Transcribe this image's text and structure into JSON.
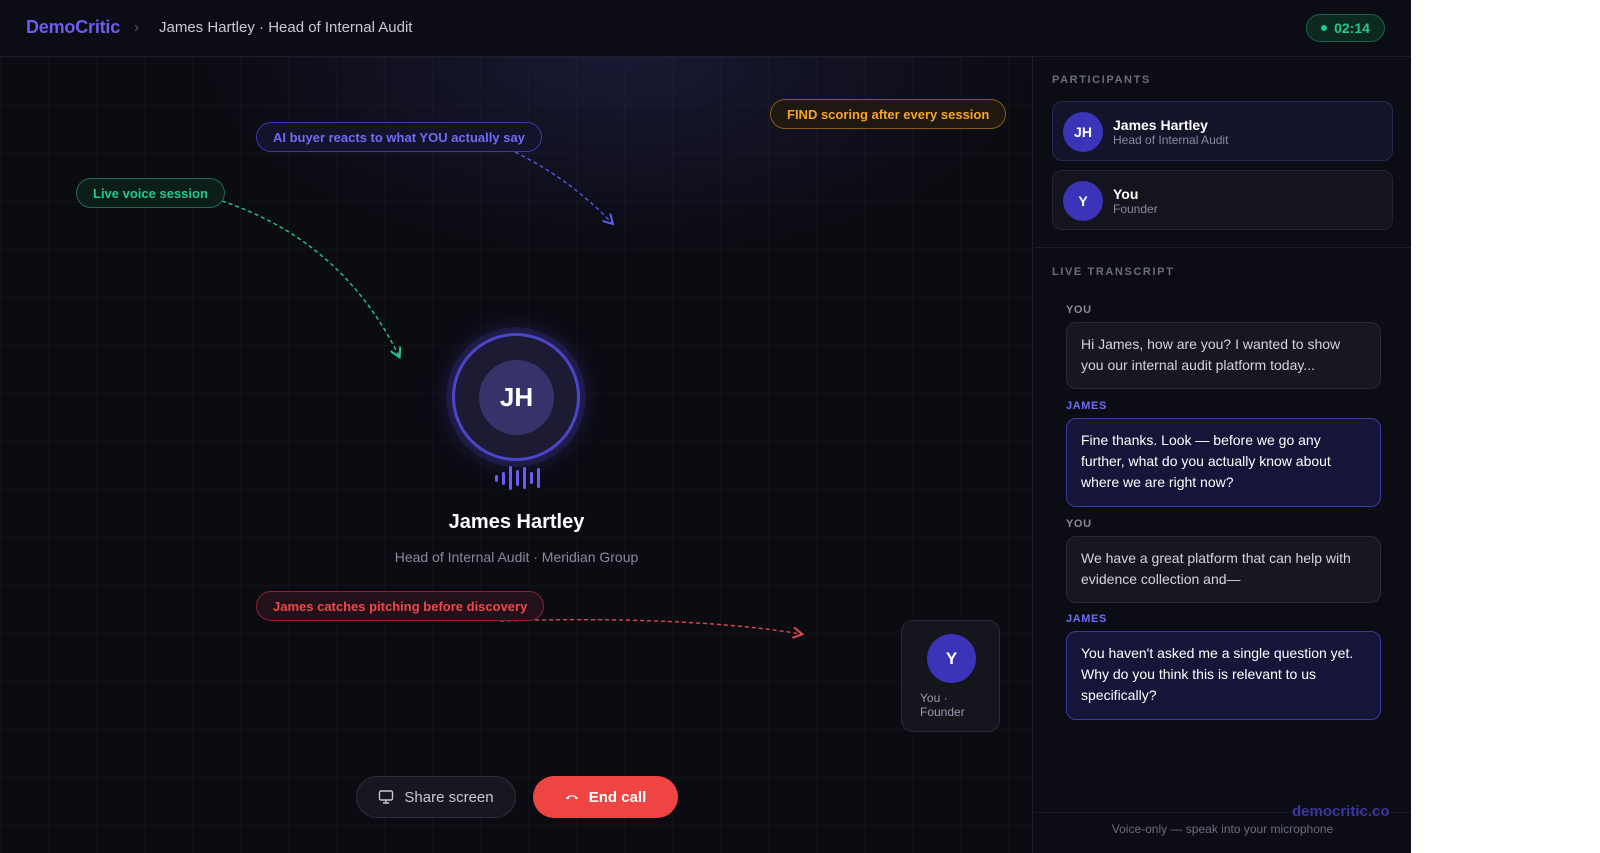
{
  "header": {
    "brand": "DemoCritic",
    "separator": "›",
    "breadcrumb": "James Hartley · Head of Internal Audit",
    "timer": "02:14"
  },
  "stage": {
    "callouts": {
      "live": "Live voice session",
      "ai": "AI buyer reacts to what YOU actually say",
      "find": "FIND scoring after every session",
      "pitch": "James catches pitching before discovery"
    },
    "buyer": {
      "initials": "JH",
      "name": "James Hartley",
      "role": "Head of Internal Audit · Meridian Group"
    },
    "self": {
      "initials": "Y",
      "label": "You · Founder"
    },
    "controls": {
      "share": "Share screen",
      "end": "End call"
    }
  },
  "sidebar": {
    "participants_title": "PARTICIPANTS",
    "participants": [
      {
        "initials": "JH",
        "name": "James Hartley",
        "role": "Head of Internal Audit"
      },
      {
        "initials": "Y",
        "name": "You",
        "role": "Founder"
      }
    ],
    "transcript_title": "LIVE TRANSCRIPT",
    "transcript": [
      {
        "speaker": "YOU",
        "text": "Hi James, how are you? I wanted to show you our internal audit platform today..."
      },
      {
        "speaker": "JAMES",
        "text": "Fine thanks. Look — before we go any further, what do you actually know about where we are right now?"
      },
      {
        "speaker": "YOU",
        "text": "We have a great platform that can help with evidence collection and—"
      },
      {
        "speaker": "JAMES",
        "text": "You haven't asked me a single question yet. Why do you think this is relevant to us specifically?"
      }
    ],
    "hint": "Voice-only — speak into your microphone"
  },
  "watermark": "democritic.co",
  "colors": {
    "accent": "#6b5cf2",
    "live_green": "#22c98a",
    "end_red": "#ef4444",
    "find_orange": "#f5a524"
  }
}
